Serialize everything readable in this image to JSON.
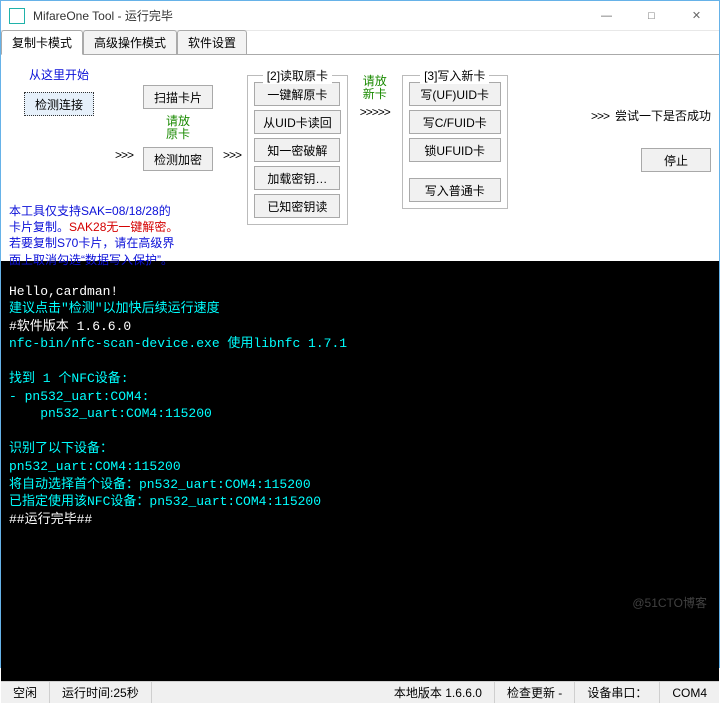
{
  "window": {
    "title": "MifareOne Tool - 运行完毕",
    "minimize": "—",
    "maximize": "□",
    "close": "✕"
  },
  "tabs": {
    "t1": "复制卡模式",
    "t2": "高级操作模式",
    "t3": "软件设置"
  },
  "flow": {
    "start_here": "从这里开始",
    "detect": "检测连接",
    "arrows1": ">>>",
    "scan": "扫描卡片",
    "please_orig_1": "请放",
    "please_orig_2": "原卡",
    "detect_enc": "检测加密",
    "arrows2": ">>>",
    "group2_title": "[2]读取原卡",
    "one_key_decode": "一键解原卡",
    "read_from_uid": "从UID卡读回",
    "known_one_crack": "知一密破解",
    "load_key": "加载密钥…",
    "known_key_read": "已知密钥读",
    "please_new_1": "请放",
    "please_new_2": "新卡",
    "arrows3": ">>>>>",
    "group3_title": "[3]写入新卡",
    "write_uf_uid": "写(UF)UID卡",
    "write_cfuid": "写C/FUID卡",
    "lock_ufuid": "锁UFUID卡",
    "write_normal": "写入普通卡",
    "arrows4": ">>>",
    "try_label": "尝试一下是否成功",
    "stop": "停止"
  },
  "note": {
    "l1": "本工具仅支持SAK=08/18/28的",
    "l2_a": "卡片复制。",
    "l2_b": "SAK28无一键解密。",
    "l3": "若要复制S70卡片，请在高级界",
    "l4": "面上取消勾选“数据写入保护”。"
  },
  "console": {
    "c1": "Hello,cardman!",
    "c2": "建议点击\"检测\"以加快后续运行速度",
    "c3": "#软件版本 1.6.6.0",
    "c4": "nfc-bin/nfc-scan-device.exe 使用libnfc 1.7.1",
    "c5": "找到 1 个NFC设备:",
    "c6": "- pn532_uart:COM4:",
    "c7": "    pn532_uart:COM4:115200",
    "c8": "识别了以下设备：",
    "c9": "pn532_uart:COM4:115200",
    "c10": "将自动选择首个设备：pn532_uart:COM4:115200",
    "c11": "已指定使用该NFC设备：pn532_uart:COM4:115200",
    "c12": "##运行完毕##"
  },
  "status": {
    "s1": "空闲",
    "s2": "运行时间:25秒",
    "s3": "本地版本 1.6.6.0",
    "s4": "检查更新 -",
    "s5": "设备串口：",
    "s6": "COM4"
  },
  "watermark": "@51CTO博客"
}
